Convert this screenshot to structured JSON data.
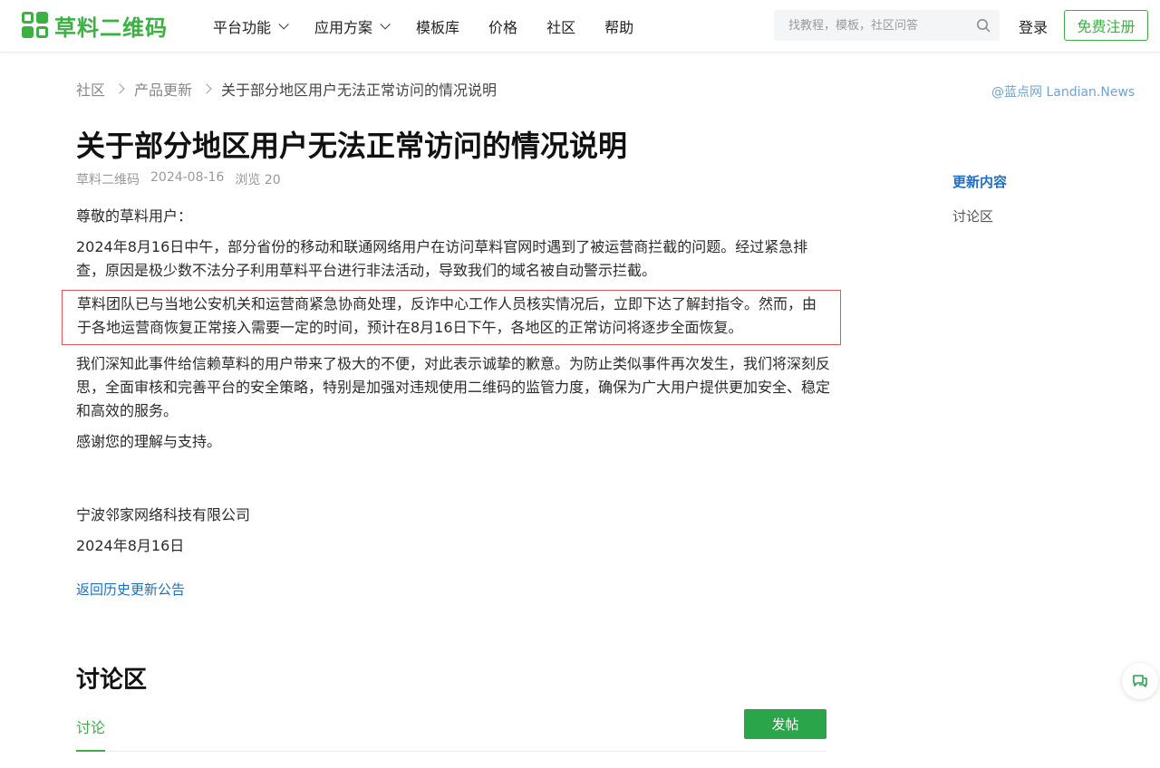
{
  "header": {
    "logo_text": "草料二维码",
    "nav": [
      {
        "label": "平台功能",
        "has_dropdown": true
      },
      {
        "label": "应用方案",
        "has_dropdown": true
      },
      {
        "label": "模板库",
        "has_dropdown": false
      },
      {
        "label": "价格",
        "has_dropdown": false
      },
      {
        "label": "社区",
        "has_dropdown": false
      },
      {
        "label": "帮助",
        "has_dropdown": false
      }
    ],
    "search_placeholder": "找教程，模板，社区问答",
    "login_label": "登录",
    "signup_label": "免费注册"
  },
  "breadcrumb": [
    "社区",
    "产品更新",
    "关于部分地区用户无法正常访问的情况说明"
  ],
  "watermark": "@蓝点网 Landian.News",
  "article": {
    "title": "关于部分地区用户无法正常访问的情况说明",
    "author": "草料二维码",
    "date": "2024-08-16",
    "views": "浏览 20",
    "greeting": "尊敬的草料用户：",
    "para1": "2024年8月16日中午，部分省份的移动和联通网络用户在访问草料官网时遇到了被运营商拦截的问题。经过紧急排查，原因是极少数不法分子利用草料平台进行非法活动，导致我们的域名被自动警示拦截。",
    "para2": "草料团队已与当地公安机关和运营商紧急协商处理，反诈中心工作人员核实情况后，立即下达了解封指令。然而，由于各地运营商恢复正常接入需要一定的时间，预计在8月16日下午，各地区的正常访问将逐步全面恢复。",
    "para3": "我们深知此事件给信赖草料的用户带来了极大的不便，对此表示诚挚的歉意。为防止类似事件再次发生，我们将深刻反思，全面审核和完善平台的安全策略，特别是加强对违规使用二维码的监管力度，确保为广大用户提供更加安全、稳定和高效的服务。",
    "thanks": "感谢您的理解与支持。",
    "company": "宁波邻家网络科技有限公司",
    "sign_date": "2024年8月16日",
    "back_link": "返回历史更新公告"
  },
  "toc": {
    "items": [
      {
        "label": "更新内容",
        "active": true
      },
      {
        "label": "讨论区",
        "active": false
      }
    ]
  },
  "discussion": {
    "title": "讨论区",
    "tab_label": "讨论",
    "post_button": "发帖"
  },
  "colors": {
    "brand_green": "#3cb043",
    "link_blue": "#1e6fc7",
    "highlight_border": "#e0565b"
  }
}
